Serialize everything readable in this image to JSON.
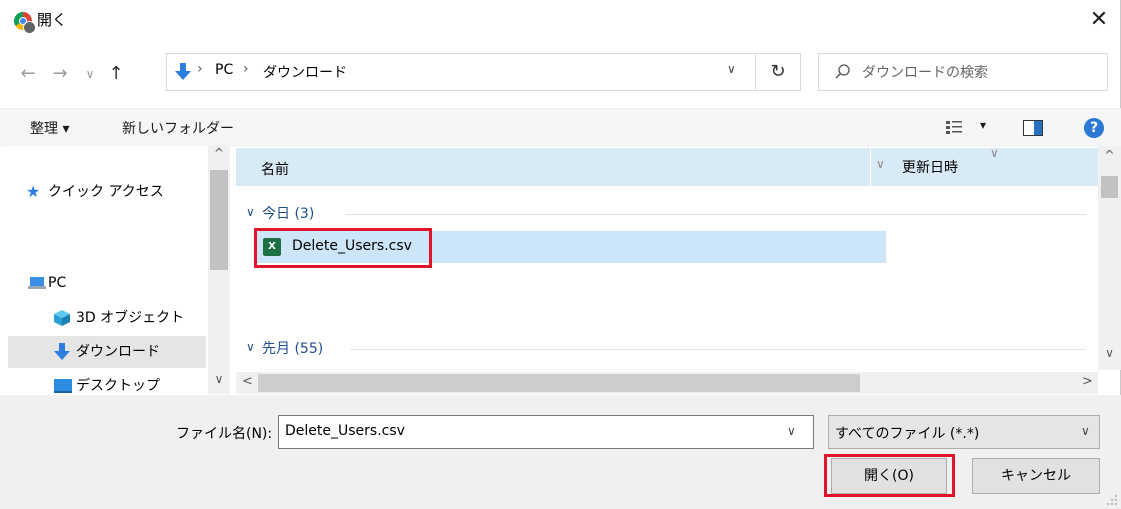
{
  "window": {
    "title": "開く",
    "close_glyph": "✕"
  },
  "nav": {
    "back": "←",
    "forward": "→",
    "recent": "∨",
    "up": "↑",
    "breadcrumb": [
      "PC",
      "ダウンロード"
    ],
    "sep": "›",
    "addr_dropdown": "∨",
    "refresh": "↻",
    "search_placeholder": "ダウンロードの検索"
  },
  "toolbar": {
    "organize": "整理 ▾",
    "new_folder": "新しいフォルダー",
    "view_caret": "▾",
    "help": "?"
  },
  "sidebar": {
    "items": [
      {
        "label": "クイック アクセス",
        "icon": "star-icon"
      },
      {
        "label": "PC",
        "icon": "pc-icon"
      },
      {
        "label": "3D オブジェクト",
        "icon": "cube-icon"
      },
      {
        "label": "ダウンロード",
        "icon": "download-icon",
        "selected": true
      },
      {
        "label": "デスクトップ",
        "icon": "desktop-icon"
      }
    ],
    "scroll_up": "^",
    "scroll_down": "∨"
  },
  "content": {
    "columns": [
      "名前",
      "更新日時"
    ],
    "groups": [
      {
        "label": "今日 (3)",
        "files": [
          {
            "name": "Delete_Users.csv",
            "icon": "excel-csv-icon"
          }
        ]
      },
      {
        "label": "先月 (55)",
        "files": []
      }
    ],
    "scroll_left": "<",
    "scroll_right": ">"
  },
  "footer": {
    "filename_label": "ファイル名(N):",
    "filename_value": "Delete_Users.csv",
    "filetype": "すべてのファイル (*.*)",
    "open_button": "開く(O)",
    "cancel_button": "キャンセル"
  },
  "colors": {
    "highlight": "#e0142b",
    "selection": "#cce5f8",
    "header": "#d9eaf7",
    "accent": "#2b78d6"
  }
}
